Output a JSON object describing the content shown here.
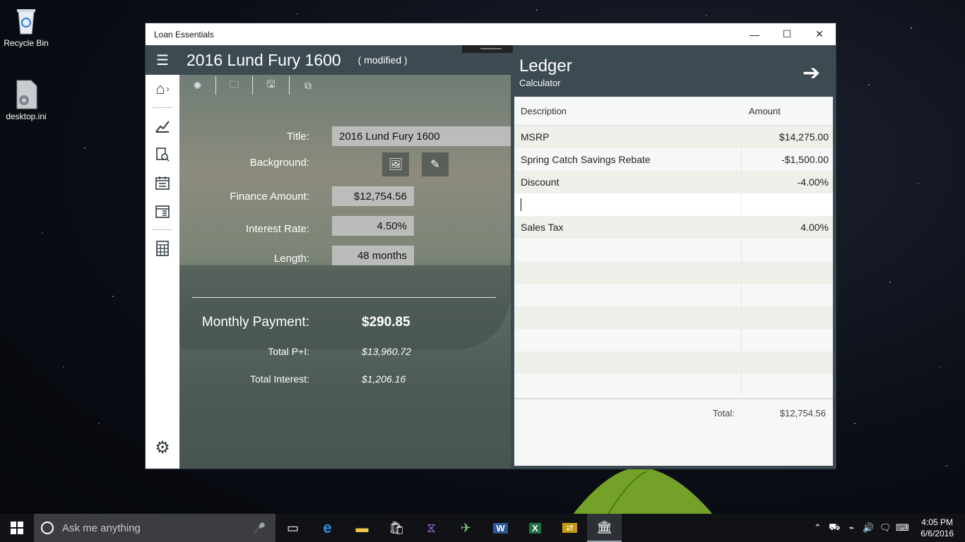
{
  "desktop": {
    "icons": [
      {
        "label": "Recycle Bin",
        "icon": "recycle-bin-icon"
      },
      {
        "label": "desktop.ini",
        "icon": "settings-file-icon"
      }
    ]
  },
  "window": {
    "title": "Loan Essentials",
    "controls": {
      "minimize": "—",
      "maximize": "☐",
      "close": "✕"
    }
  },
  "header": {
    "doc_title": "2016 Lund Fury 1600",
    "modified": "( modified )"
  },
  "form": {
    "title_label": "Title:",
    "title_value": "2016 Lund Fury 1600",
    "background_label": "Background:",
    "finance_label": "Finance Amount:",
    "finance_value": "$12,754.56",
    "rate_label": "Interest Rate:",
    "rate_value": "4.50%",
    "length_label": "Length:",
    "length_value": "48 months",
    "payment_label": "Monthly Payment:",
    "payment_value": "$290.85",
    "total_pi_label": "Total P+I:",
    "total_pi_value": "$13,960.72",
    "total_interest_label": "Total Interest:",
    "total_interest_value": "$1,206.16"
  },
  "ledger": {
    "title": "Ledger",
    "subtitle": "Calculator",
    "columns": [
      "Description",
      "Amount"
    ],
    "rows": [
      {
        "description": "MSRP",
        "amount": "$14,275.00"
      },
      {
        "description": "Spring Catch Savings Rebate",
        "amount": "-$1,500.00"
      },
      {
        "description": "Discount",
        "amount": "-4.00%"
      },
      {
        "description": "",
        "amount": ""
      },
      {
        "description": "Sales Tax",
        "amount": "4.00%"
      }
    ],
    "total_label": "Total:",
    "total_value": "$12,754.56"
  },
  "taskbar": {
    "search_placeholder": "Ask me anything",
    "time": "4:05 PM",
    "date": "6/6/2016"
  },
  "colors": {
    "accent": "#3c4a52",
    "ledger_alt_row": "#eef0ea"
  }
}
